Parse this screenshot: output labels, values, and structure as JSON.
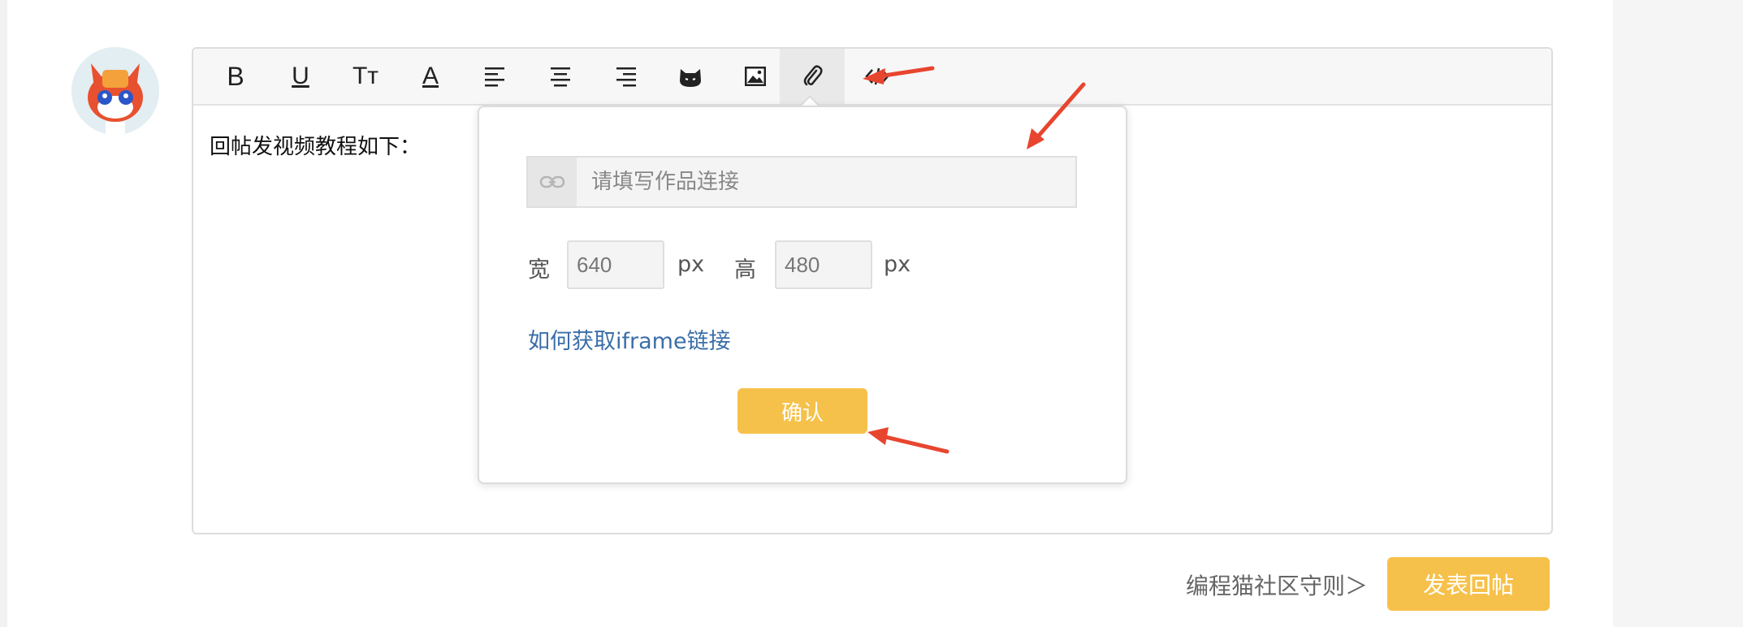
{
  "toolbar": {
    "tools": [
      {
        "name": "bold",
        "label": "B"
      },
      {
        "name": "underline",
        "label": "U"
      },
      {
        "name": "font-size",
        "label": "Tт"
      },
      {
        "name": "font-color",
        "label": "A"
      },
      {
        "name": "align-left"
      },
      {
        "name": "align-center"
      },
      {
        "name": "align-right"
      },
      {
        "name": "emoji-cat"
      },
      {
        "name": "image"
      },
      {
        "name": "attachment-link",
        "active": true
      },
      {
        "name": "code-embed"
      }
    ]
  },
  "editor": {
    "content": "回帖发视频教程如下："
  },
  "embed_popup": {
    "link_placeholder": "请填写作品连接",
    "width_label": "宽",
    "width_value": "640",
    "width_unit": "px",
    "height_label": "高",
    "height_value": "480",
    "height_unit": "px",
    "help_link": "如何获取iframe链接",
    "confirm_label": "确认"
  },
  "footer": {
    "rules_link": "编程猫社区守则＞",
    "submit_label": "发表回帖"
  },
  "colors": {
    "accent": "#f6c14a",
    "link": "#3a6ea8",
    "annotation_arrow": "#e8452f"
  }
}
